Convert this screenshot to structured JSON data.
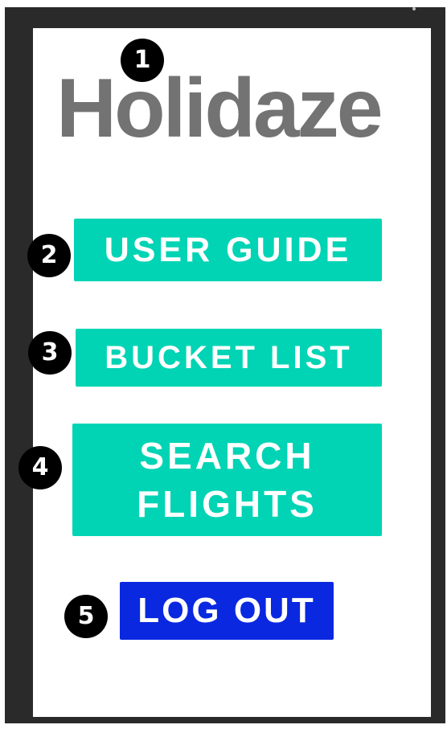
{
  "app": {
    "title": "Holidaze"
  },
  "menu": {
    "user_guide": "USER GUIDE",
    "bucket_list": "BUCKET LIST",
    "search_flights": "SEARCH\nFLIGHTS",
    "log_out": "LOG OUT"
  },
  "badges": [
    "1",
    "2",
    "3",
    "4",
    "5"
  ],
  "colors": {
    "title": "#737373",
    "primary_button": "#00d4b4",
    "logout_button": "#0a28e0",
    "badge": "#000000",
    "frame": "#2a2a2a"
  },
  "icons": {
    "badge_shape": "numbered-circle-icon"
  }
}
